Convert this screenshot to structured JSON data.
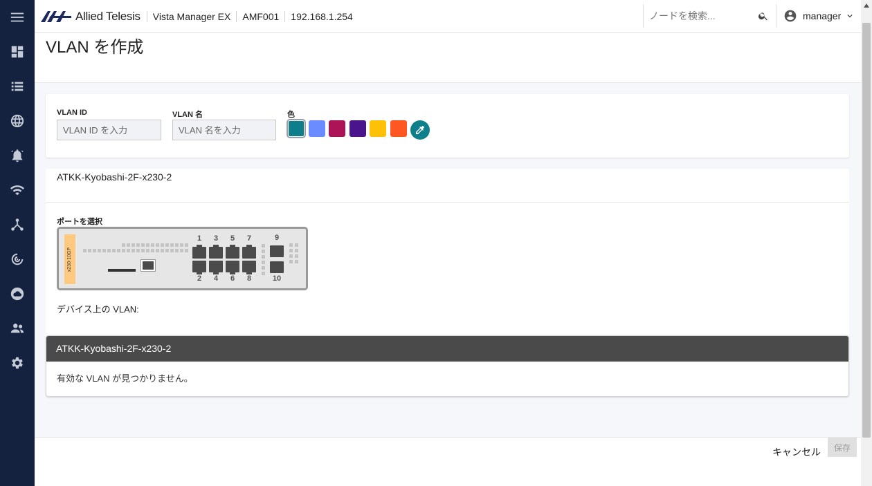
{
  "sidebar": {
    "items": [
      {
        "name": "menu",
        "icon": "hamburger-menu-icon"
      },
      {
        "name": "dashboard",
        "icon": "dashboard-icon"
      },
      {
        "name": "list",
        "icon": "list-icon"
      },
      {
        "name": "network",
        "icon": "globe-icon"
      },
      {
        "name": "alarms",
        "icon": "alarm-bell-icon"
      },
      {
        "name": "wireless",
        "icon": "wifi-icon"
      },
      {
        "name": "topology",
        "icon": "topology-icon"
      },
      {
        "name": "radar",
        "icon": "radar-icon"
      },
      {
        "name": "cloud",
        "icon": "cloud-icon"
      },
      {
        "name": "users",
        "icon": "users-icon"
      },
      {
        "name": "settings",
        "icon": "gear-icon"
      }
    ]
  },
  "header": {
    "brand": "Allied Telesis",
    "product": "Vista Manager EX",
    "network": "AMF001",
    "ip": "192.168.1.254",
    "search_placeholder": "ノードを検索...",
    "username": "manager"
  },
  "page": {
    "title": "VLAN を作成"
  },
  "form": {
    "vlan_id_label": "VLAN ID",
    "vlan_id_placeholder": "VLAN ID を入力",
    "vlan_name_label": "VLAN 名",
    "vlan_name_placeholder": "VLAN 名を入力",
    "color_label": "色",
    "colors": [
      "#0e7f8a",
      "#6b8cff",
      "#ad1457",
      "#4a148c",
      "#ffc107",
      "#ff5722"
    ],
    "selected_color": "#0e7f8a"
  },
  "device": {
    "name": "ATKK-Kyobashi-2F-x230-2",
    "select_port_label": "ポートを選択",
    "model": "x230-10GP",
    "top_ports": [
      "1",
      "3",
      "5",
      "7",
      "9"
    ],
    "bottom_ports": [
      "2",
      "4",
      "6",
      "8",
      "10"
    ],
    "device_vlans_label": "デバイス上の VLAN:"
  },
  "vlan_panel": {
    "title": "ATKK-Kyobashi-2F-x230-2",
    "empty_message": "有効な VLAN が見つかりません。"
  },
  "footer": {
    "cancel_label": "キャンセル",
    "save_label": "保存"
  }
}
